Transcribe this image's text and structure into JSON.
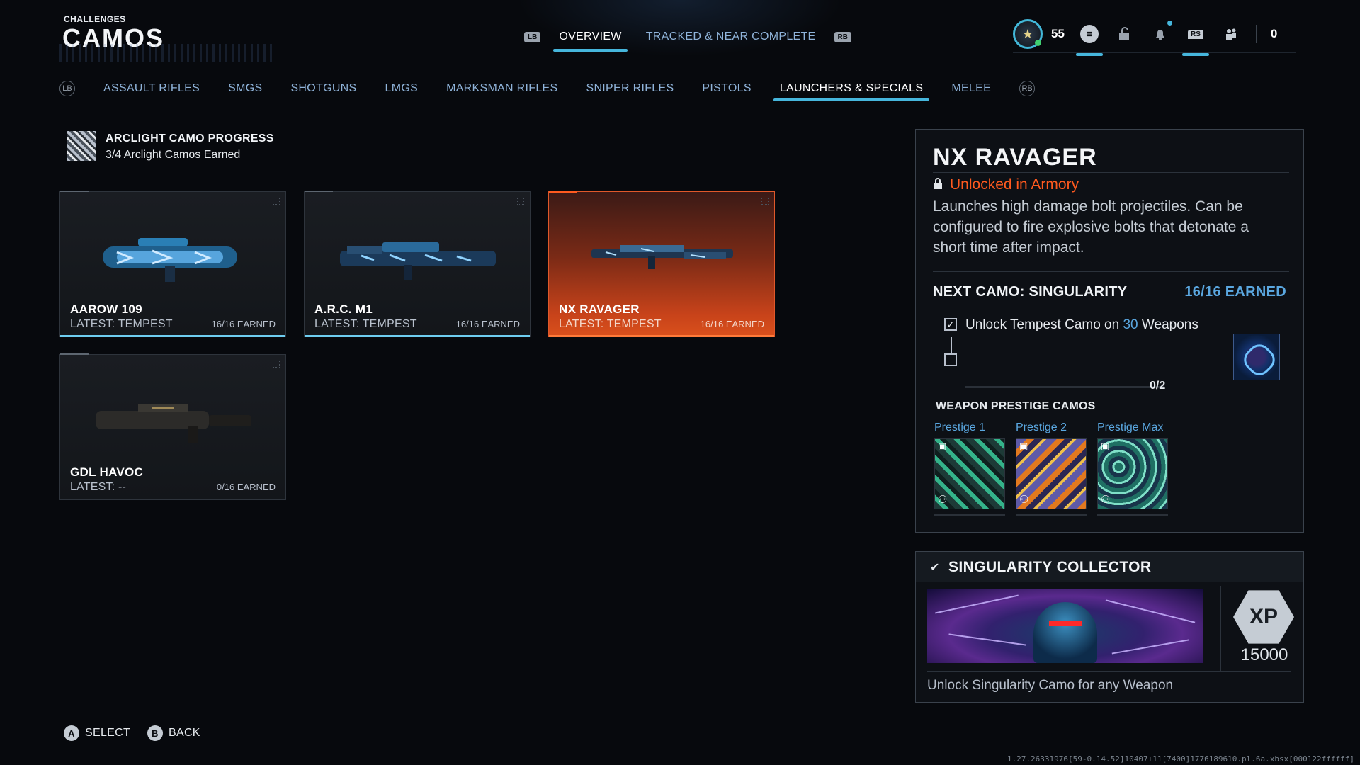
{
  "header": {
    "subtitle": "CHALLENGES",
    "title": "CAMOS"
  },
  "top_tabs": {
    "lb": "LB",
    "rb": "RB",
    "items": [
      {
        "label": "OVERVIEW",
        "active": true
      },
      {
        "label": "TRACKED & NEAR COMPLETE",
        "active": false
      }
    ]
  },
  "hud": {
    "level": "55",
    "rs_label": "RS",
    "count": "0",
    "icons": [
      "rank-icon",
      "menu-icon",
      "locker-icon",
      "notification-icon",
      "social-icon",
      "party-icon"
    ]
  },
  "categories": {
    "lb_icon": "LB",
    "rb_icon": "RB",
    "items": [
      {
        "label": "ASSAULT RIFLES",
        "active": false
      },
      {
        "label": "SMGS",
        "active": false
      },
      {
        "label": "SHOTGUNS",
        "active": false
      },
      {
        "label": "LMGS",
        "active": false
      },
      {
        "label": "MARKSMAN RIFLES",
        "active": false
      },
      {
        "label": "SNIPER RIFLES",
        "active": false
      },
      {
        "label": "PISTOLS",
        "active": false
      },
      {
        "label": "LAUNCHERS & SPECIALS",
        "active": true
      },
      {
        "label": "MELEE",
        "active": false
      }
    ]
  },
  "progress": {
    "title": "ARCLIGHT CAMO PROGRESS",
    "subtitle": "3/4 Arclight Camos Earned"
  },
  "weapons": [
    {
      "name": "AAROW 109",
      "latest": "LATEST: TEMPEST",
      "earned": "16/16 EARNED",
      "selected": false,
      "progress": 1.0
    },
    {
      "name": "A.R.C. M1",
      "latest": "LATEST: TEMPEST",
      "earned": "16/16 EARNED",
      "selected": false,
      "progress": 1.0
    },
    {
      "name": "NX RAVAGER",
      "latest": "LATEST: TEMPEST",
      "earned": "16/16 EARNED",
      "selected": true,
      "progress": 1.0
    },
    {
      "name": "GDL HAVOC",
      "latest": "LATEST: --",
      "earned": "0/16 EARNED",
      "selected": false,
      "progress": 0.0
    }
  ],
  "detail": {
    "title": "NX RAVAGER",
    "unlock": "Unlocked in Armory",
    "description": "Launches high damage bolt projectiles. Can be configured to fire explosive bolts that detonate a short time after impact.",
    "next_camo": "NEXT CAMO: SINGULARITY",
    "next_count": "16/16 EARNED",
    "task_prefix": "Unlock Tempest Camo on",
    "task_num": "30",
    "task_suffix": "Weapons",
    "task_count": "0/2",
    "prestige_heading": "WEAPON PRESTIGE CAMOS",
    "prestige": [
      {
        "label": "Prestige 1"
      },
      {
        "label": "Prestige 2"
      },
      {
        "label": "Prestige Max"
      }
    ]
  },
  "collector": {
    "title": "SINGULARITY COLLECTOR",
    "xp_badge": "XP",
    "xp_value": "15000",
    "description": "Unlock Singularity Camo for any Weapon"
  },
  "footer": {
    "select_btn": "A",
    "select_label": "SELECT",
    "back_btn": "B",
    "back_label": "BACK",
    "build": "1.27.26331976[59-0.14.52]10407+11[7400]1776189610.pl.6a.xbsx[000122ffffff]"
  },
  "colors": {
    "accent": "#46b6dc",
    "selected_card": "#d9501c",
    "unlock_text": "#ff5a1f",
    "blue_text": "#5aa7e0"
  }
}
